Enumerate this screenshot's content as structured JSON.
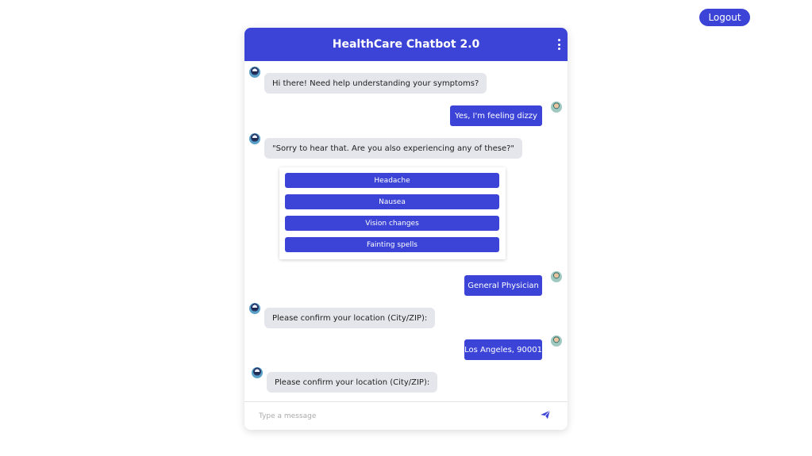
{
  "page": {
    "logout_label": "Logout"
  },
  "chat": {
    "title": "HealthCare Chatbot 2.0",
    "messages": [
      {
        "from": "bot",
        "text": "Hi there! Need help understanding your symptoms?"
      },
      {
        "from": "user",
        "text": "Yes, I'm feeling dizzy"
      },
      {
        "from": "bot",
        "text": "\"Sorry to hear that. Are you also experiencing any of these?\""
      },
      {
        "from": "user",
        "text": "General Physician"
      },
      {
        "from": "bot",
        "text": "Please confirm your location (City/ZIP):"
      },
      {
        "from": "user",
        "text": "Los Angeles, 90001"
      },
      {
        "from": "bot",
        "text": "Please confirm your location (City/ZIP):"
      }
    ],
    "options": [
      "Headache",
      "Nausea",
      "Vision changes",
      "Fainting spells"
    ],
    "input": {
      "placeholder": "Type a message",
      "value": ""
    }
  },
  "colors": {
    "accent": "#3b44d6",
    "bot_bubble": "#e4e6ec"
  },
  "icons": {
    "menu": "kebab-menu-icon",
    "send": "paper-plane-icon"
  }
}
